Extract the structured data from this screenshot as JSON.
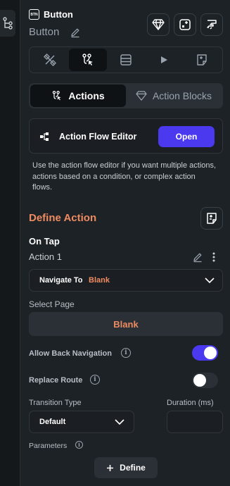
{
  "header": {
    "badge_text": "BTN",
    "title": "Button",
    "widget_name": "Button"
  },
  "actions_toggle": {
    "actions_label": "Actions",
    "action_blocks_label": "Action Blocks"
  },
  "flow_editor": {
    "title": "Action Flow Editor",
    "open_label": "Open",
    "help_text": "Use the action flow editor if you want multiple actions, actions based on a condition, or complex action flows."
  },
  "define_action": {
    "title": "Define Action",
    "trigger": "On Tap",
    "action_name": "Action 1",
    "navigate_label": "Navigate To",
    "navigate_target": "Blank",
    "select_page_label": "Select Page",
    "selected_page": "Blank",
    "allow_back_label": "Allow Back Navigation",
    "allow_back_on": true,
    "replace_route_label": "Replace Route",
    "replace_route_on": false,
    "transition_type_label": "Transition Type",
    "transition_type_value": "Default",
    "duration_label": "Duration (ms)",
    "duration_value": "",
    "parameters_label": "Parameters",
    "define_button_label": "Define"
  },
  "colors": {
    "accent": "#4b39ef",
    "orange": "#ee8b60",
    "panel_bg": "#1d2227"
  },
  "icons": [
    "flow-icon",
    "pencil-icon",
    "diamond-icon",
    "add-widget-icon",
    "theme-icon",
    "settings-tab-icon",
    "actions-tab-icon",
    "backend-query-icon",
    "play-icon",
    "add-note-icon",
    "chevron-down-icon",
    "info-icon",
    "more-vertical-icon",
    "plus-icon"
  ]
}
